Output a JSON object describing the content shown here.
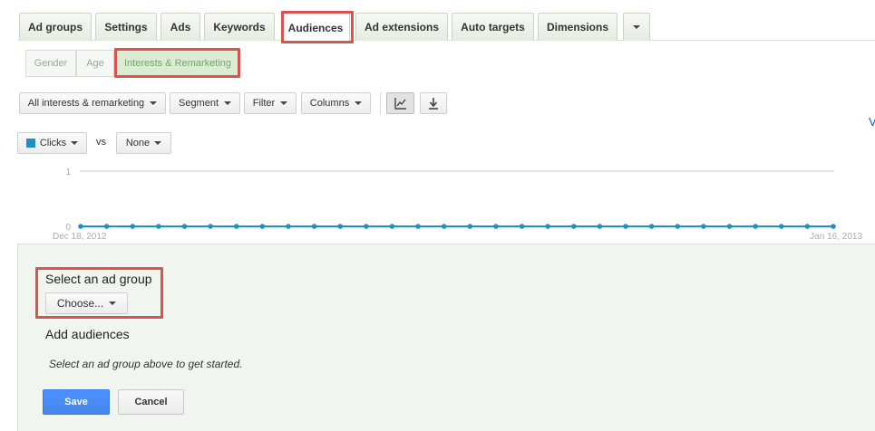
{
  "tabs": [
    {
      "label": "Ad groups"
    },
    {
      "label": "Settings"
    },
    {
      "label": "Ads"
    },
    {
      "label": "Keywords"
    },
    {
      "label": "Audiences",
      "active": true
    },
    {
      "label": "Ad extensions"
    },
    {
      "label": "Auto targets"
    },
    {
      "label": "Dimensions"
    }
  ],
  "more_tabs_icon": "chevron-down-icon",
  "subtabs": [
    {
      "label": "Gender"
    },
    {
      "label": "Age"
    },
    {
      "label": "Interests & Remarketing",
      "active": true
    }
  ],
  "toolbar": {
    "view_filter": "All interests & remarketing",
    "segment": "Segment",
    "filter": "Filter",
    "columns": "Columns",
    "chart_icon": "line-chart-icon",
    "download_icon": "download-icon"
  },
  "edge_link": "V",
  "metrics": {
    "primary": "Clicks",
    "primary_color": "#1f8fc4",
    "vs": "vs",
    "secondary": "None"
  },
  "chart_data": {
    "type": "line",
    "title": "",
    "xlabel": "",
    "ylabel": "",
    "ylim": [
      0,
      1
    ],
    "yticks": [
      "1",
      "0"
    ],
    "x_start_label": "Dec 18, 2012",
    "x_end_label": "Jan 16, 2013",
    "series": [
      {
        "values": [
          0,
          0,
          0,
          0,
          0,
          0,
          0,
          0,
          0,
          0,
          0,
          0,
          0,
          0,
          0,
          0,
          0,
          0,
          0,
          0,
          0,
          0,
          0,
          0,
          0,
          0,
          0,
          0,
          0,
          0
        ],
        "color": "#1f8fc4"
      }
    ]
  },
  "panel": {
    "select_label": "Select an ad group",
    "choose_label": "Choose...",
    "add_audiences": "Add audiences",
    "hint": "Select an ad group above to get started.",
    "save": "Save",
    "cancel": "Cancel"
  },
  "colors": {
    "highlight": "#d9534f",
    "save_button": "#4d90fe",
    "panel_bg": "#f1f5ef"
  }
}
